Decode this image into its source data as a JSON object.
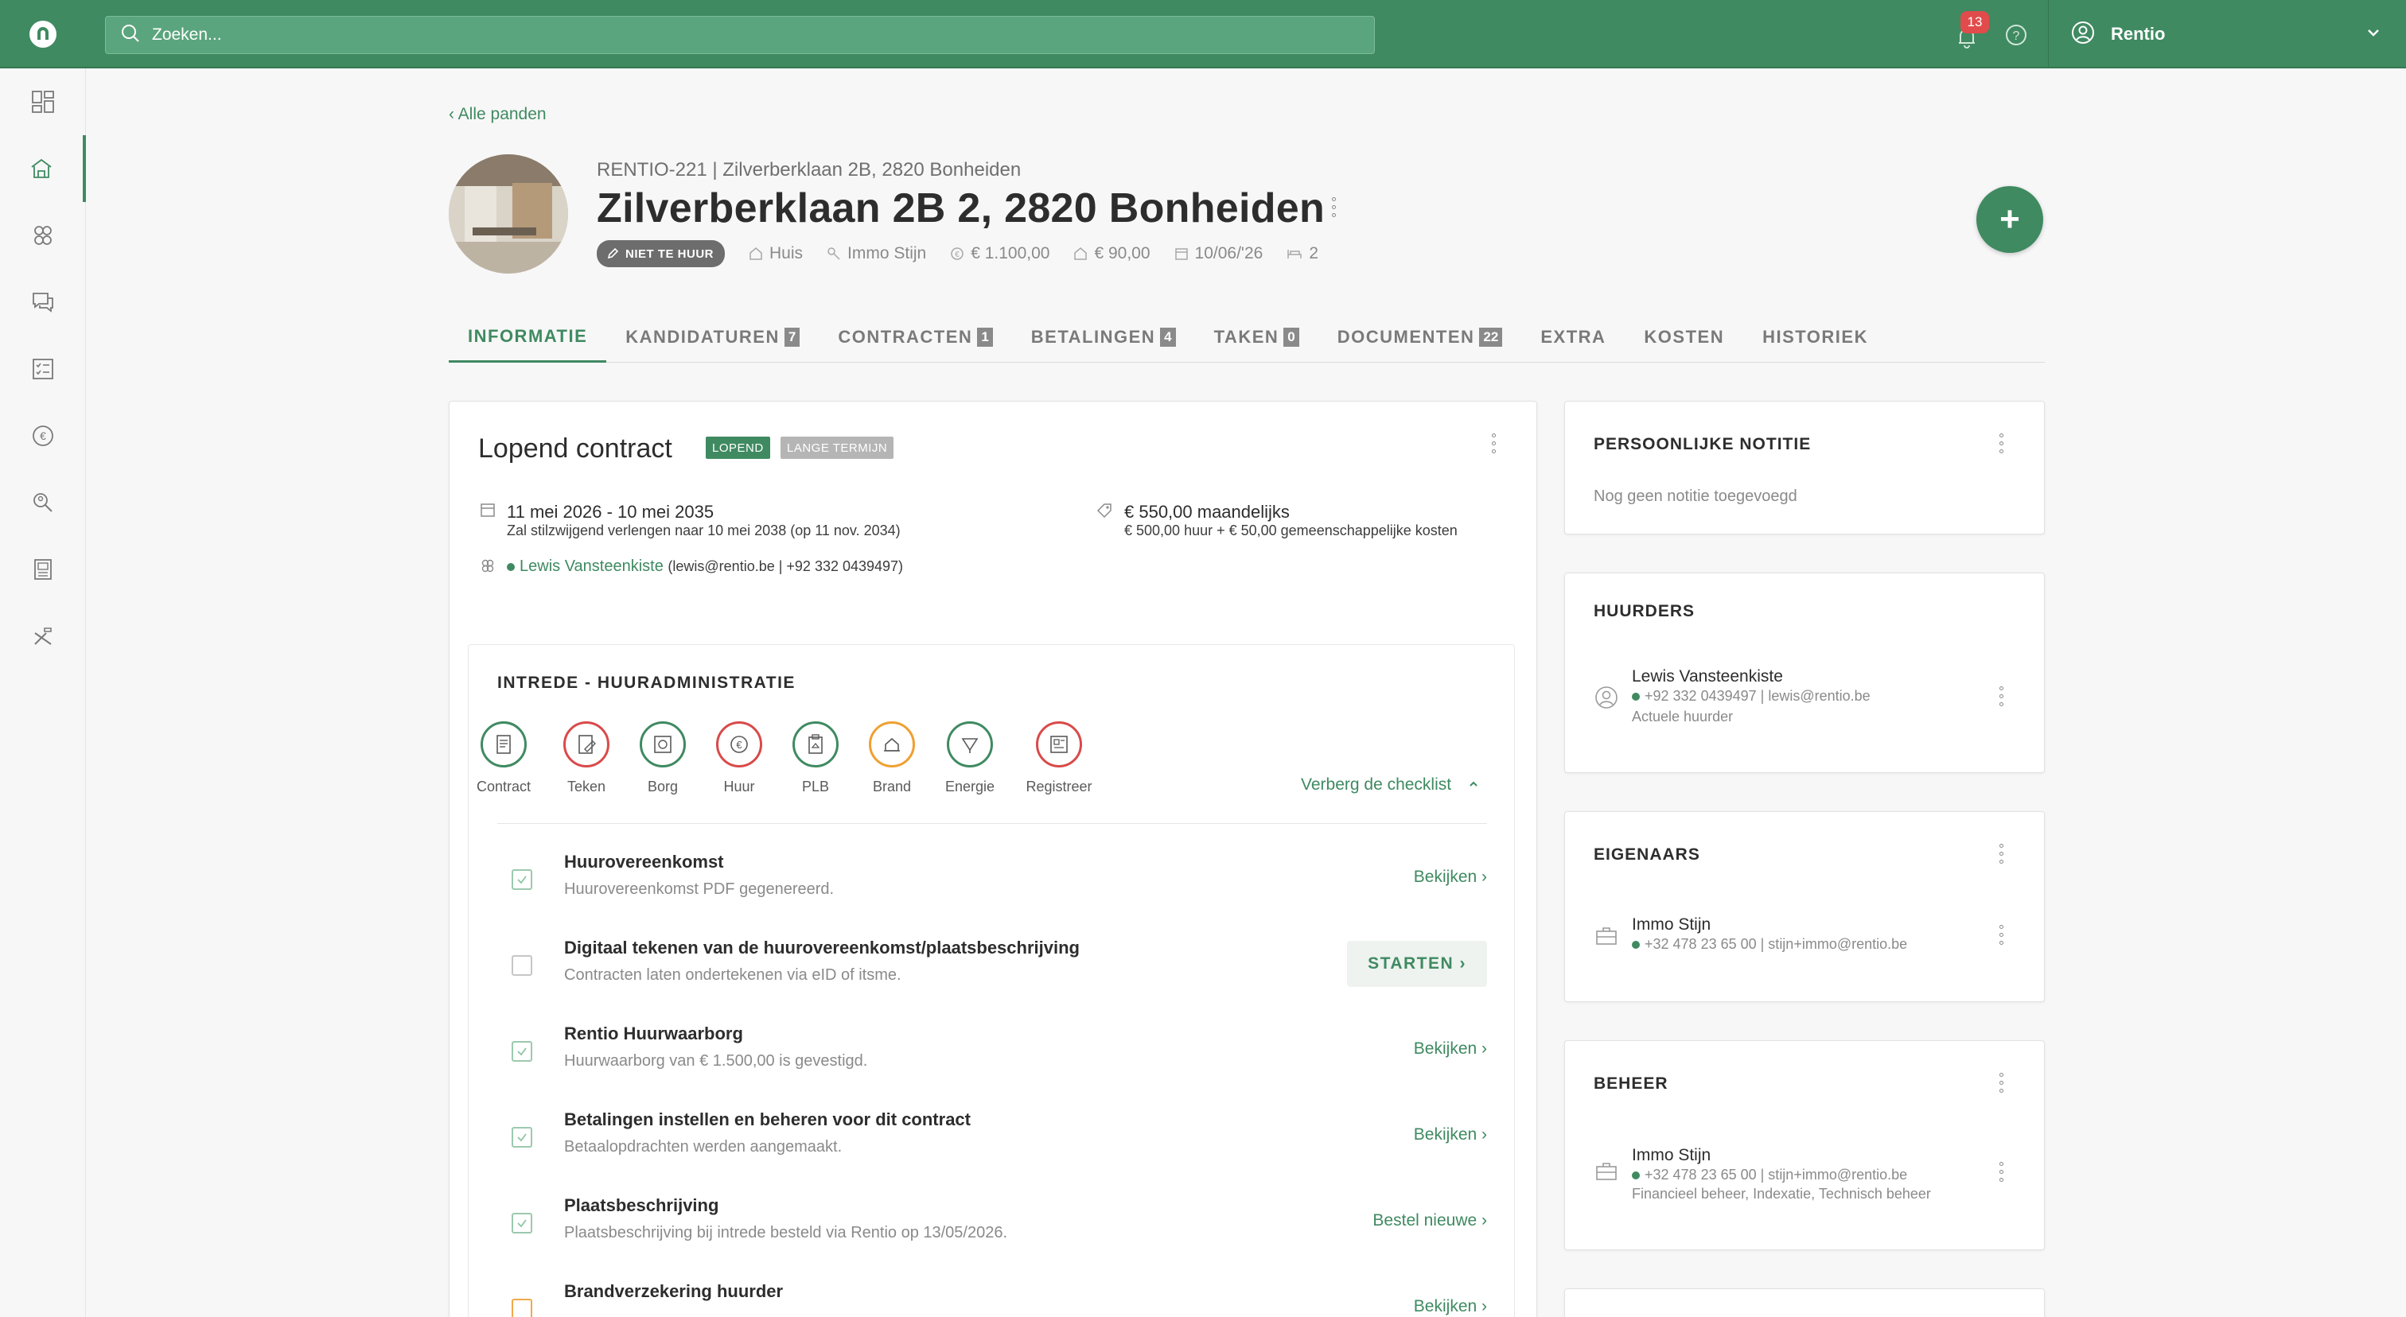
{
  "topbar": {
    "search_placeholder": "Zoeken...",
    "notifications_count": "13",
    "user_name": "Rentio",
    "brand_color": "#3f8a61"
  },
  "sidebar": {
    "items": [
      {
        "icon": "dashboard-icon"
      },
      {
        "icon": "properties-icon",
        "active": true
      },
      {
        "icon": "contacts-icon"
      },
      {
        "icon": "chat-icon"
      },
      {
        "icon": "tasks-icon"
      },
      {
        "icon": "euro-icon"
      },
      {
        "icon": "search-users-icon"
      },
      {
        "icon": "documents-icon"
      },
      {
        "icon": "tools-icon"
      }
    ]
  },
  "breadcrumb": "‹ Alle panden",
  "property": {
    "subtitle": "RENTIO-221 | Zilverberklaan 2B, 2820 Bonheiden",
    "title": "Zilverberklaan 2B 2, 2820 Bonheiden",
    "status_pill": "NIET TE HUUR",
    "type": "Huis",
    "owner": "Immo Stijn",
    "rent": "€ 1.100,00",
    "costs": "€ 90,00",
    "date": "10/06/'26",
    "rooms": "2"
  },
  "tabs": [
    {
      "label": "INFORMATIE",
      "count": "",
      "active": true
    },
    {
      "label": "KANDIDATUREN",
      "count": "7"
    },
    {
      "label": "CONTRACTEN",
      "count": "1"
    },
    {
      "label": "BETALINGEN",
      "count": "4"
    },
    {
      "label": "TAKEN",
      "count": "0"
    },
    {
      "label": "DOCUMENTEN",
      "count": "22"
    },
    {
      "label": "EXTRA",
      "count": ""
    },
    {
      "label": "KOSTEN",
      "count": ""
    },
    {
      "label": "HISTORIEK",
      "count": ""
    }
  ],
  "contract": {
    "title": "Lopend contract",
    "tag_running": "LOPEND",
    "tag_term": "LANGE TERMIJN",
    "period": "11 mei 2026 - 10 mei 2035",
    "period_note": "Zal stilzwijgend verlengen naar 10 mei 2038 (op 11 nov. 2034)",
    "price": "€ 550,00 maandelijks",
    "price_note": "€ 500,00 huur + € 50,00 gemeenschappelijke kosten",
    "tenant_name": "Lewis Vansteenkiste",
    "tenant_contact": "(lewis@rentio.be | +92 332 0439497)"
  },
  "checklist": {
    "title": "INTREDE - HUURADMINISTRATIE",
    "toggle_label": "Verberg de checklist",
    "steps": [
      {
        "label": "Contract",
        "color": "#3f8a61"
      },
      {
        "label": "Teken",
        "color": "#d94a4a"
      },
      {
        "label": "Borg",
        "color": "#3f8a61"
      },
      {
        "label": "Huur",
        "color": "#d94a4a"
      },
      {
        "label": "PLB",
        "color": "#3f8a61"
      },
      {
        "label": "Brand",
        "color": "#f0a030"
      },
      {
        "label": "Energie",
        "color": "#3f8a61"
      },
      {
        "label": "Registreer",
        "color": "#d94a4a"
      }
    ],
    "items": [
      {
        "title": "Huurovereenkomst",
        "subtitle": "Huurovereenkomst PDF gegenereerd.",
        "action": "Bekijken ›",
        "state": "done"
      },
      {
        "title": "Digitaal tekenen van de huurovereenkomst/plaatsbeschrijving",
        "subtitle": "Contracten laten ondertekenen via eID of itsme.",
        "action": "STARTEN ›",
        "state": "todo"
      },
      {
        "title": "Rentio Huurwaarborg",
        "subtitle": "Huurwaarborg van € 1.500,00 is gevestigd.",
        "action": "Bekijken ›",
        "state": "done"
      },
      {
        "title": "Betalingen instellen en beheren voor dit contract",
        "subtitle": "Betaalopdrachten werden aangemaakt.",
        "action": "Bekijken ›",
        "state": "done"
      },
      {
        "title": "Plaatsbeschrijving",
        "subtitle": "Plaatsbeschrijving bij intrede besteld via Rentio op 13/05/2026.",
        "action": "Bestel nieuwe ›",
        "state": "done"
      },
      {
        "title": "Brandverzekering huurder",
        "subtitle": "",
        "action": "Bekijken ›",
        "state": "warn"
      }
    ]
  },
  "note_card": {
    "title": "PERSOONLIJKE NOTITIE",
    "empty": "Nog geen notitie toegevoegd"
  },
  "tenants_card": {
    "title": "HUURDERS",
    "name": "Lewis Vansteenkiste",
    "contact": "+92 332 0439497 | lewis@rentio.be",
    "role": "Actuele huurder"
  },
  "owners_card": {
    "title": "EIGENAARS",
    "name": "Immo Stijn",
    "contact": "+32 478 23 65 00 | stijn+immo@rentio.be"
  },
  "management_card": {
    "title": "BEHEER",
    "name": "Immo Stijn",
    "contact": "+32 478 23 65 00 | stijn+immo@rentio.be",
    "roles": "Financieel beheer, Indexatie, Technisch beheer"
  }
}
